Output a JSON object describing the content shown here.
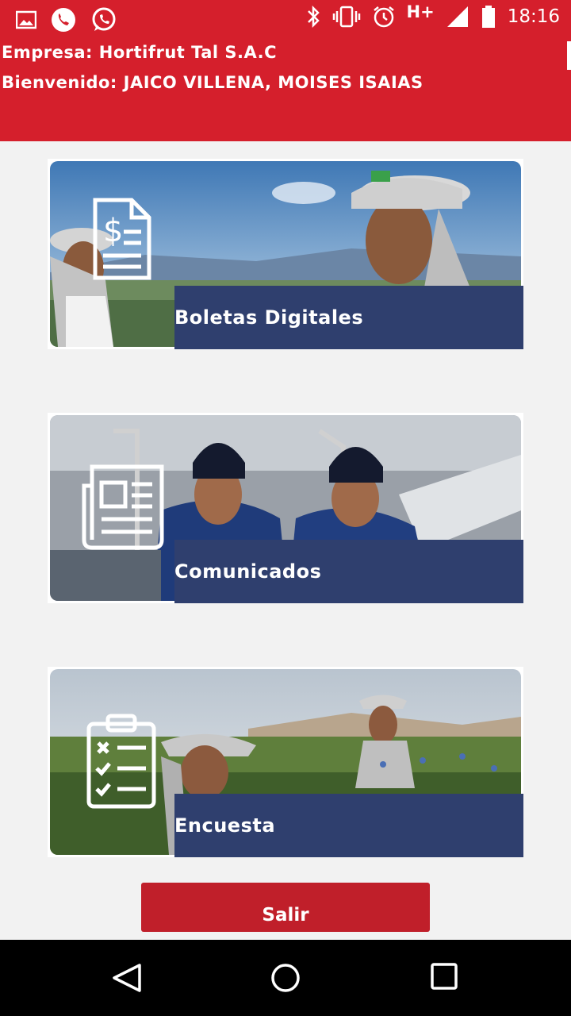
{
  "status_bar": {
    "time": "18:16",
    "network": "H+",
    "left_icons": [
      "image-icon",
      "phone-icon",
      "whatsapp-icon"
    ],
    "right_icons": [
      "bluetooth-icon",
      "vibrate-icon",
      "alarm-icon",
      "signal-icon",
      "battery-icon"
    ]
  },
  "header": {
    "company": "Empresa: Hortifrut Tal S.A.C",
    "welcome": "Bienvenido: JAICO VILLENA, MOISES ISAIAS"
  },
  "menu": {
    "items": [
      {
        "label": "Boletas Digitales",
        "icon": "invoice-icon"
      },
      {
        "label": "Comunicados",
        "icon": "newspaper-icon"
      },
      {
        "label": "Encuesta",
        "icon": "checklist-icon"
      }
    ]
  },
  "logout_label": "Salir",
  "colors": {
    "brand_red": "#d51f2c",
    "button_red": "#c01f2a",
    "label_navy": "#2f3f6e",
    "background": "#f2f2f2"
  },
  "nav_bar": {
    "icons": [
      "back-icon",
      "home-icon",
      "recents-icon"
    ]
  }
}
